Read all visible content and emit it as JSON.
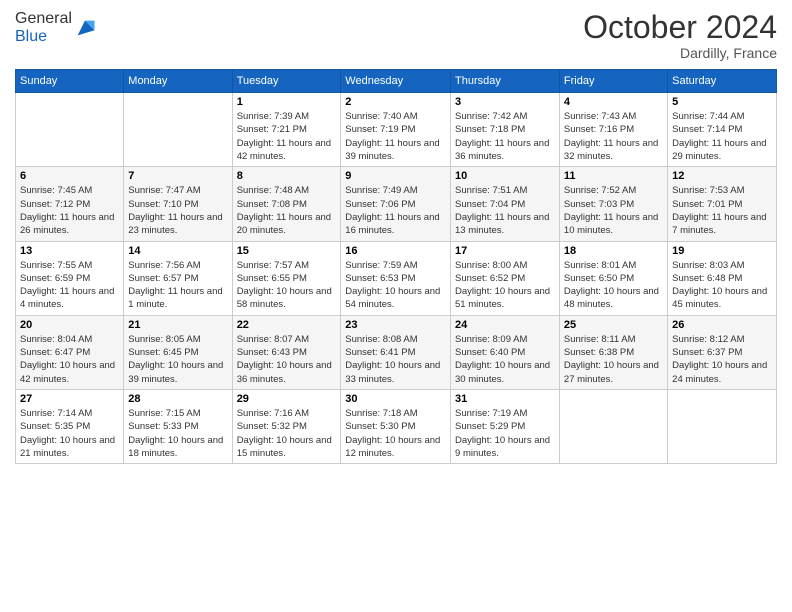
{
  "header": {
    "logo_general": "General",
    "logo_blue": "Blue",
    "month": "October 2024",
    "location": "Dardilly, France"
  },
  "weekdays": [
    "Sunday",
    "Monday",
    "Tuesday",
    "Wednesday",
    "Thursday",
    "Friday",
    "Saturday"
  ],
  "weeks": [
    [
      null,
      null,
      {
        "day": 1,
        "sunrise": "7:39 AM",
        "sunset": "7:21 PM",
        "daylight": "11 hours and 42 minutes."
      },
      {
        "day": 2,
        "sunrise": "7:40 AM",
        "sunset": "7:19 PM",
        "daylight": "11 hours and 39 minutes."
      },
      {
        "day": 3,
        "sunrise": "7:42 AM",
        "sunset": "7:18 PM",
        "daylight": "11 hours and 36 minutes."
      },
      {
        "day": 4,
        "sunrise": "7:43 AM",
        "sunset": "7:16 PM",
        "daylight": "11 hours and 32 minutes."
      },
      {
        "day": 5,
        "sunrise": "7:44 AM",
        "sunset": "7:14 PM",
        "daylight": "11 hours and 29 minutes."
      }
    ],
    [
      {
        "day": 6,
        "sunrise": "7:45 AM",
        "sunset": "7:12 PM",
        "daylight": "11 hours and 26 minutes."
      },
      {
        "day": 7,
        "sunrise": "7:47 AM",
        "sunset": "7:10 PM",
        "daylight": "11 hours and 23 minutes."
      },
      {
        "day": 8,
        "sunrise": "7:48 AM",
        "sunset": "7:08 PM",
        "daylight": "11 hours and 20 minutes."
      },
      {
        "day": 9,
        "sunrise": "7:49 AM",
        "sunset": "7:06 PM",
        "daylight": "11 hours and 16 minutes."
      },
      {
        "day": 10,
        "sunrise": "7:51 AM",
        "sunset": "7:04 PM",
        "daylight": "11 hours and 13 minutes."
      },
      {
        "day": 11,
        "sunrise": "7:52 AM",
        "sunset": "7:03 PM",
        "daylight": "11 hours and 10 minutes."
      },
      {
        "day": 12,
        "sunrise": "7:53 AM",
        "sunset": "7:01 PM",
        "daylight": "11 hours and 7 minutes."
      }
    ],
    [
      {
        "day": 13,
        "sunrise": "7:55 AM",
        "sunset": "6:59 PM",
        "daylight": "11 hours and 4 minutes."
      },
      {
        "day": 14,
        "sunrise": "7:56 AM",
        "sunset": "6:57 PM",
        "daylight": "11 hours and 1 minute."
      },
      {
        "day": 15,
        "sunrise": "7:57 AM",
        "sunset": "6:55 PM",
        "daylight": "10 hours and 58 minutes."
      },
      {
        "day": 16,
        "sunrise": "7:59 AM",
        "sunset": "6:53 PM",
        "daylight": "10 hours and 54 minutes."
      },
      {
        "day": 17,
        "sunrise": "8:00 AM",
        "sunset": "6:52 PM",
        "daylight": "10 hours and 51 minutes."
      },
      {
        "day": 18,
        "sunrise": "8:01 AM",
        "sunset": "6:50 PM",
        "daylight": "10 hours and 48 minutes."
      },
      {
        "day": 19,
        "sunrise": "8:03 AM",
        "sunset": "6:48 PM",
        "daylight": "10 hours and 45 minutes."
      }
    ],
    [
      {
        "day": 20,
        "sunrise": "8:04 AM",
        "sunset": "6:47 PM",
        "daylight": "10 hours and 42 minutes."
      },
      {
        "day": 21,
        "sunrise": "8:05 AM",
        "sunset": "6:45 PM",
        "daylight": "10 hours and 39 minutes."
      },
      {
        "day": 22,
        "sunrise": "8:07 AM",
        "sunset": "6:43 PM",
        "daylight": "10 hours and 36 minutes."
      },
      {
        "day": 23,
        "sunrise": "8:08 AM",
        "sunset": "6:41 PM",
        "daylight": "10 hours and 33 minutes."
      },
      {
        "day": 24,
        "sunrise": "8:09 AM",
        "sunset": "6:40 PM",
        "daylight": "10 hours and 30 minutes."
      },
      {
        "day": 25,
        "sunrise": "8:11 AM",
        "sunset": "6:38 PM",
        "daylight": "10 hours and 27 minutes."
      },
      {
        "day": 26,
        "sunrise": "8:12 AM",
        "sunset": "6:37 PM",
        "daylight": "10 hours and 24 minutes."
      }
    ],
    [
      {
        "day": 27,
        "sunrise": "7:14 AM",
        "sunset": "5:35 PM",
        "daylight": "10 hours and 21 minutes."
      },
      {
        "day": 28,
        "sunrise": "7:15 AM",
        "sunset": "5:33 PM",
        "daylight": "10 hours and 18 minutes."
      },
      {
        "day": 29,
        "sunrise": "7:16 AM",
        "sunset": "5:32 PM",
        "daylight": "10 hours and 15 minutes."
      },
      {
        "day": 30,
        "sunrise": "7:18 AM",
        "sunset": "5:30 PM",
        "daylight": "10 hours and 12 minutes."
      },
      {
        "day": 31,
        "sunrise": "7:19 AM",
        "sunset": "5:29 PM",
        "daylight": "10 hours and 9 minutes."
      },
      null,
      null
    ]
  ],
  "labels": {
    "sunrise": "Sunrise:",
    "sunset": "Sunset:",
    "daylight": "Daylight:"
  }
}
